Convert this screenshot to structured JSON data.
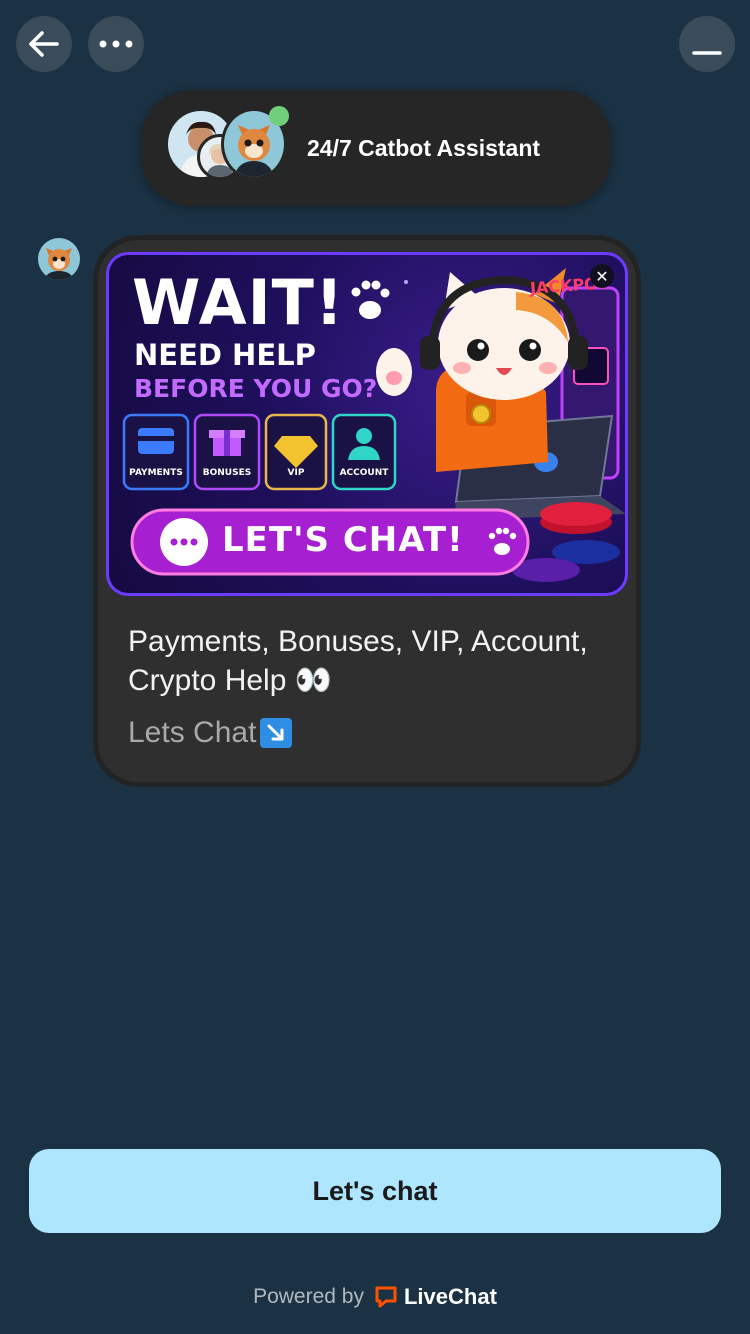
{
  "nav": {
    "back_icon": "arrow-left-icon",
    "menu_icon": "more-horizontal-icon",
    "minimize_icon": "minimize-icon"
  },
  "header": {
    "title": "24/7 Catbot Assistant",
    "online_color": "#6fcf7a"
  },
  "message": {
    "banner": {
      "headline": "WAIT!",
      "line1": "NEED HELP",
      "line2": "BEFORE YOU GO?",
      "jackpot": "JACKPOT",
      "categories": [
        "PAYMENTS",
        "BONUSES",
        "VIP",
        "ACCOUNT"
      ],
      "cta": "LET'S CHAT!"
    },
    "text": "Payments, Bonuses, VIP, Account, Crypto Help 👀",
    "subtext": "Lets Chat"
  },
  "cta_button": {
    "label": "Let's chat"
  },
  "footer": {
    "powered_by": "Powered by",
    "brand": "LiveChat",
    "brand_color": "#ff5100"
  },
  "colors": {
    "background": "#1b3244",
    "cta": "#aee6ff",
    "card": "#2f2f2f"
  }
}
